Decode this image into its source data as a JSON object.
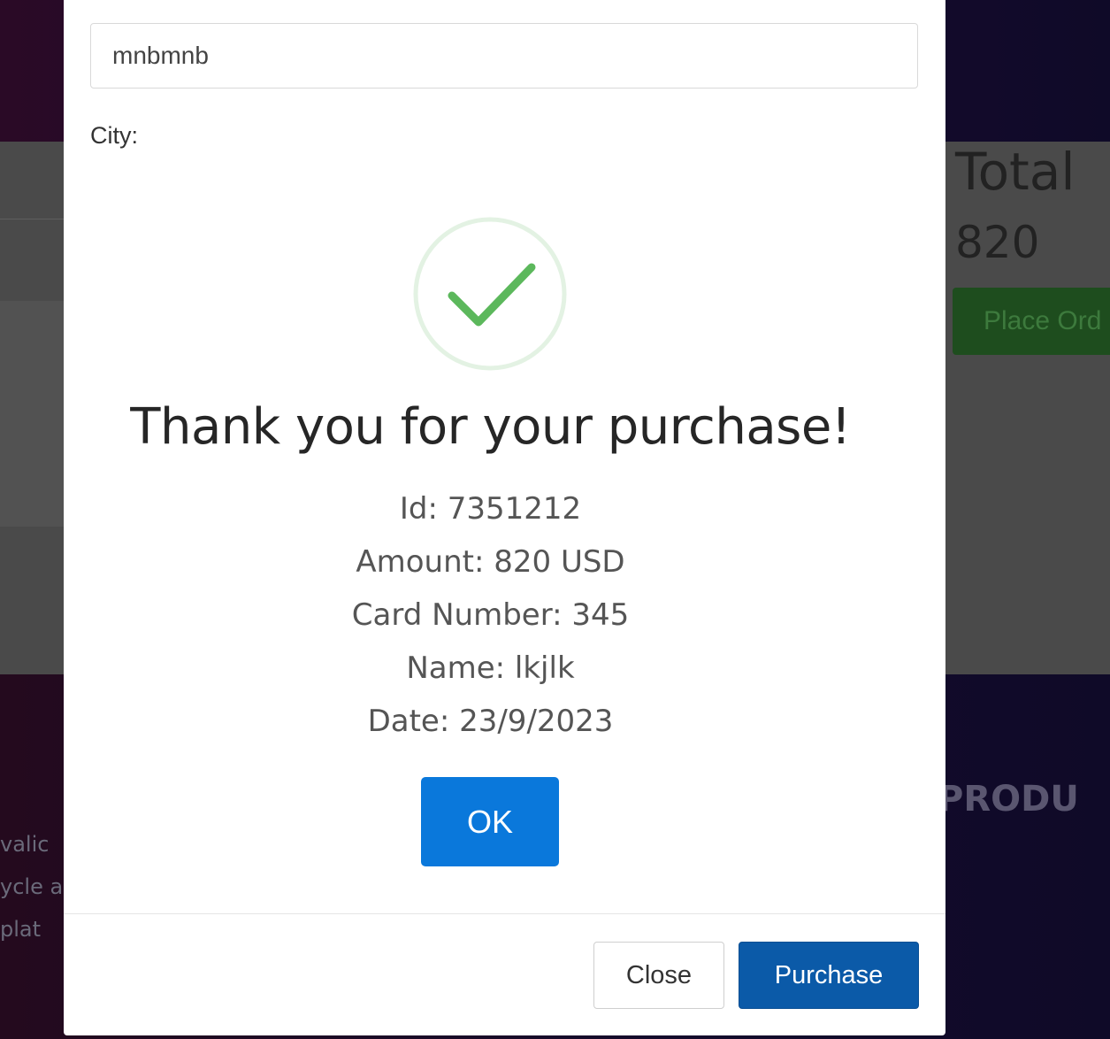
{
  "background": {
    "cart_total_label": "Total",
    "cart_total_value": "820",
    "place_order_label": "Place Ord",
    "footer_heading": "PRODU",
    "footer_fragments": [
      "valic",
      "ycle a",
      "plat"
    ]
  },
  "modal": {
    "address_value": "mnbmnb",
    "city_label": "City:",
    "close_label": "Close",
    "purchase_label": "Purchase"
  },
  "alert": {
    "title": "Thank you for your purchase!",
    "id_line": "Id: 7351212",
    "amount_line": "Amount: 820 USD",
    "card_line": "Card Number: 345",
    "name_line": "Name: lkjlk",
    "date_line": "Date: 23/9/2023",
    "ok_label": "OK"
  },
  "colors": {
    "success_green": "#5cb85c",
    "ok_blue": "#0a78db",
    "purchase_blue": "#0b5aa8"
  }
}
